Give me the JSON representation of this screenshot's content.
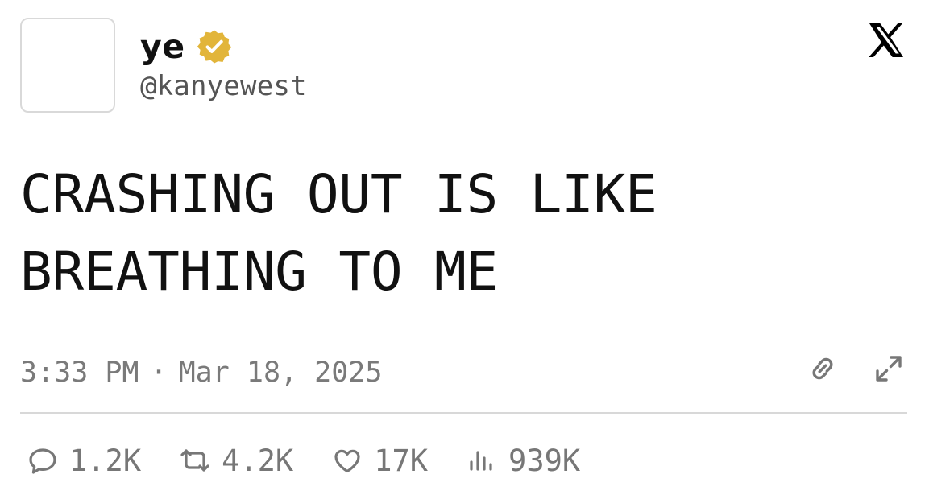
{
  "user": {
    "display_name": "ye",
    "handle": "@kanyewest"
  },
  "tweet": {
    "text": "CRASHING OUT IS LIKE BREATHING TO ME",
    "time": "3:33 PM",
    "separator": "·",
    "date": "Mar 18, 2025"
  },
  "stats": {
    "replies": "1.2K",
    "reposts": "4.2K",
    "likes": "17K",
    "views": "939K"
  },
  "icons": {
    "brand": "x-logo",
    "verified": "verified-badge-icon",
    "link": "link-icon",
    "expand": "expand-icon",
    "reply": "reply-icon",
    "repost": "repost-icon",
    "like": "heart-icon",
    "views": "views-icon"
  },
  "colors": {
    "verified_badge": "#e2b53a",
    "text_primary": "#111111",
    "text_secondary": "#7a7a7a",
    "divider": "#d8d8d8"
  }
}
